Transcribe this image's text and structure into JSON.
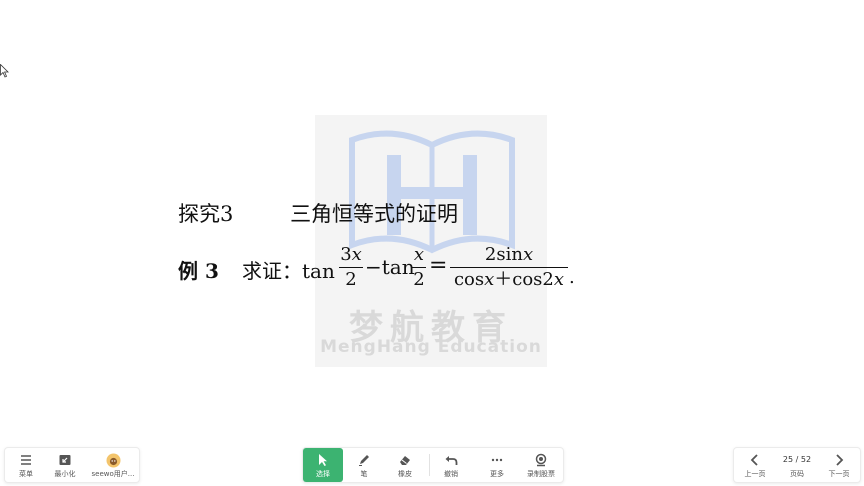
{
  "watermark": {
    "brand_cn": "梦航教育",
    "brand_en": "MengHang Education"
  },
  "slide": {
    "explore_label": "探究3",
    "explore_title": "三角恒等式的证明",
    "example_label": "例 3",
    "prove_text": "求证：tan",
    "frac1_num_a": "3",
    "frac1_num_b": "x",
    "frac1_den": "2",
    "minus_tan": "−tan",
    "frac2_num": "x",
    "frac2_den": "2",
    "equals": "=",
    "frac3_num_a": "2sin",
    "frac3_num_b": "x",
    "frac3_den_a": "cos",
    "frac3_den_b": "x",
    "frac3_den_c": "＋cos2",
    "frac3_den_d": "x",
    "period": "."
  },
  "toolbar_left": {
    "menu_label": "菜单",
    "minimize_label": "最小化",
    "user_label": "seewo用户..."
  },
  "toolbar_center": {
    "select_label": "选择",
    "pen_label": "笔",
    "eraser_label": "橡皮",
    "undo_label": "撤销",
    "more_label": "更多",
    "record_label": "录制股票"
  },
  "toolbar_right": {
    "prev_label": "上一页",
    "page_indicator": "25 / 52",
    "page_label": "页码",
    "next_label": "下一页"
  },
  "colors": {
    "active_tool": "#3cb371",
    "watermark_book": "#c7d5ef"
  },
  "icons": [
    "pointer-cursor-icon",
    "menu-icon",
    "minimize-icon",
    "avatar-icon",
    "select-arrow-icon",
    "pen-icon",
    "eraser-icon",
    "undo-icon",
    "more-dots-icon",
    "record-icon",
    "chevron-left-icon",
    "chevron-right-icon"
  ]
}
